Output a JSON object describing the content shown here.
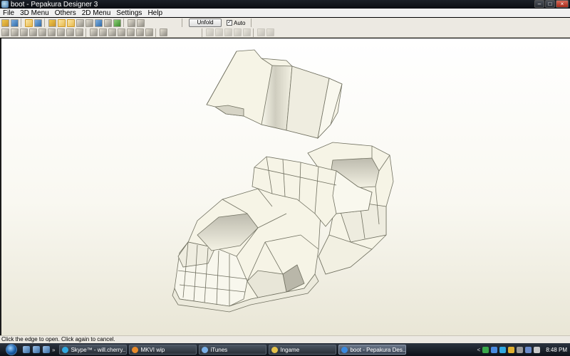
{
  "window": {
    "title": "boot - Pepakura Designer 3"
  },
  "menu": [
    "File",
    "3D Menu",
    "Others",
    "2D Menu",
    "Settings",
    "Help"
  ],
  "toolbar": {
    "unfold_label": "Unfold",
    "auto_label": "Auto",
    "auto_checked": true
  },
  "status": {
    "text": "Click the edge to open. Click again to cancel."
  },
  "taskbar": {
    "quick_launch_more": "»",
    "tasks": [
      {
        "label": "Skype™ - will.cherry...",
        "icon_color": "#31a8e0"
      },
      {
        "label": "MKVI wip",
        "icon_color": "#e88a2a"
      },
      {
        "label": "iTunes",
        "icon_color": "#7ab0e8"
      },
      {
        "label": "Ingame",
        "icon_color": "#e6c24a"
      },
      {
        "label": "boot - Pepakura Des...",
        "icon_color": "#3a8ae0",
        "active": true
      }
    ],
    "tray_chevron": "<",
    "clock": "8:48 PM"
  },
  "colors": {
    "model_fill": "#f6f4e6",
    "model_shade": "#c9c7b8",
    "edge_color": "#707060",
    "viewport_bg_bottom": "#e9e6d6"
  }
}
